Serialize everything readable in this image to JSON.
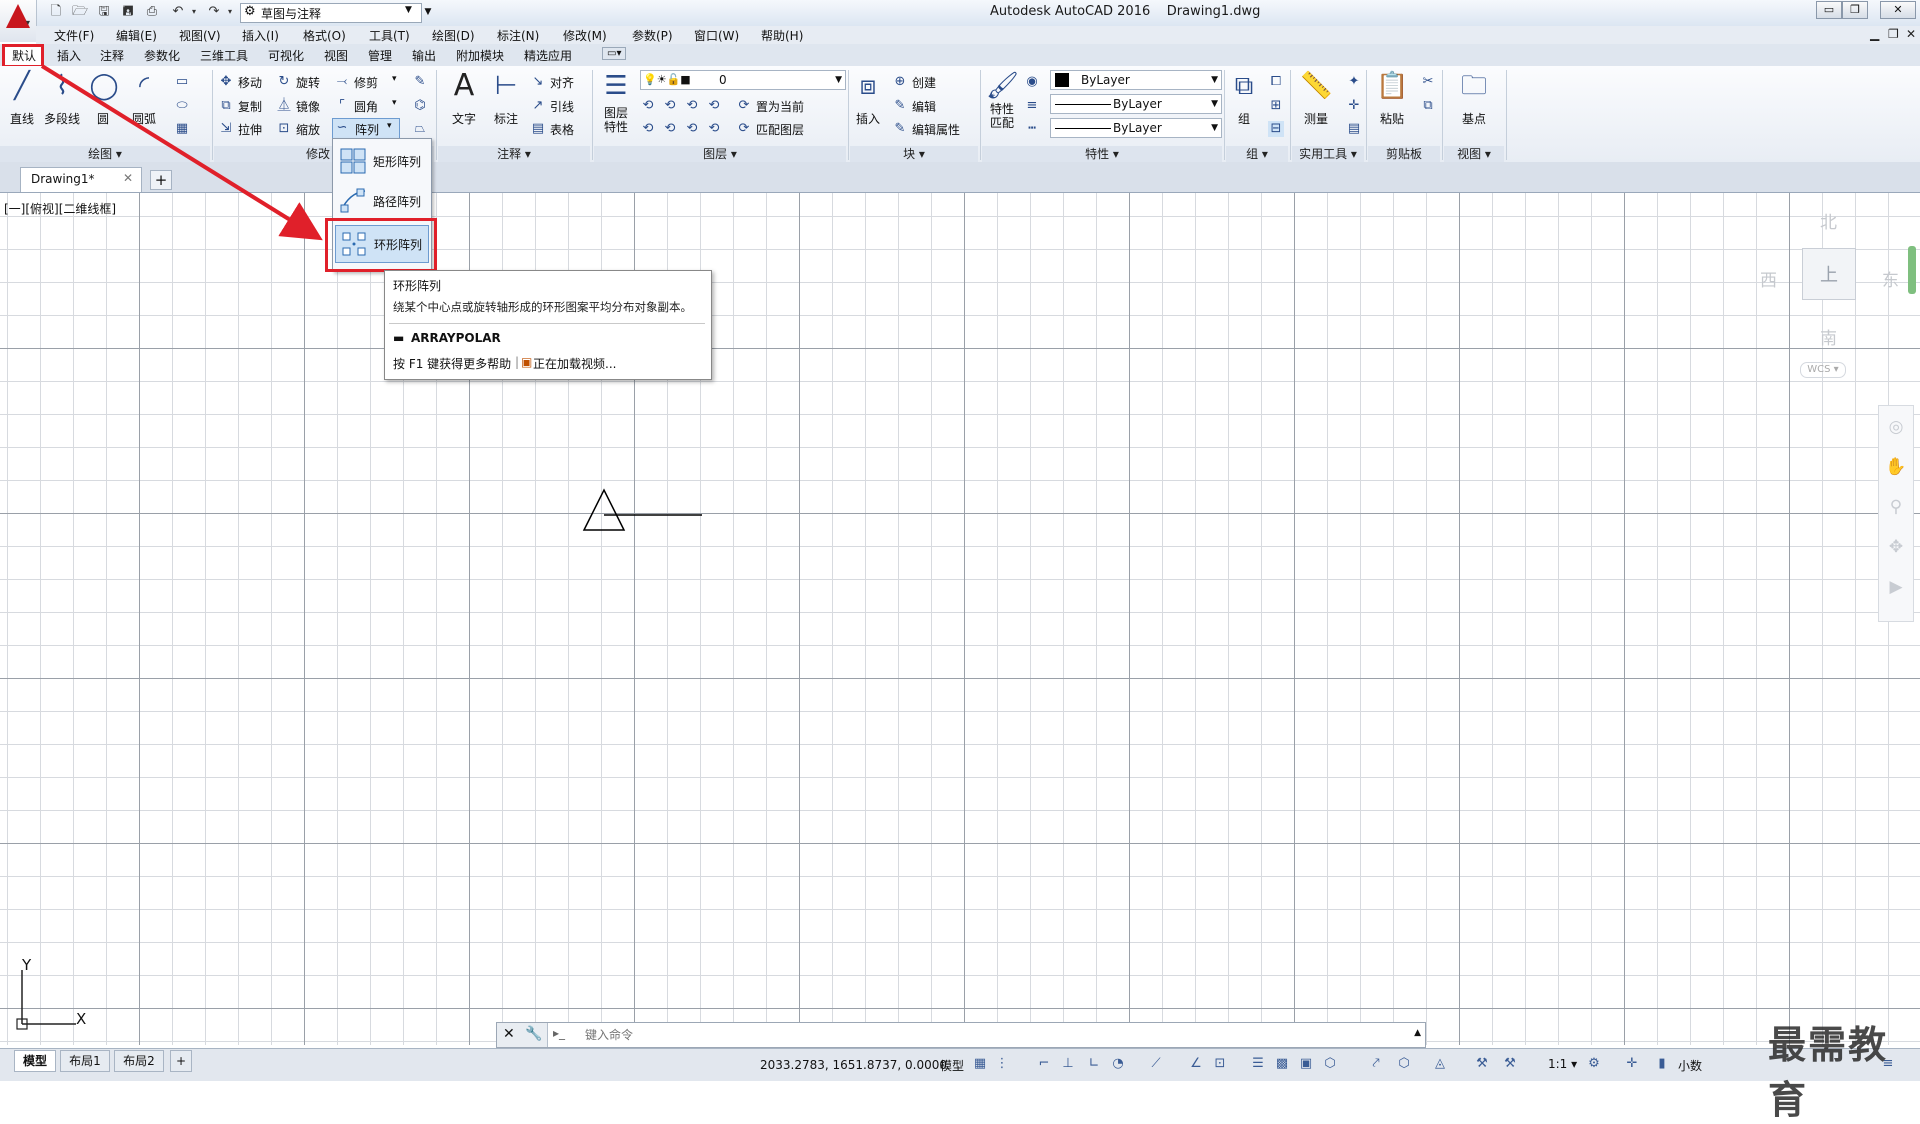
{
  "window": {
    "title": "Autodesk AutoCAD 2016    Drawing1.dwg",
    "workspace": "草图与注释",
    "min": "▭",
    "restore": "❐",
    "close": "✕"
  },
  "menubar": {
    "items": [
      "文件(F)",
      "编辑(E)",
      "视图(V)",
      "插入(I)",
      "格式(O)",
      "工具(T)",
      "绘图(D)",
      "标注(N)",
      "修改(M)",
      "参数(P)",
      "窗口(W)",
      "帮助(H)"
    ],
    "right": [
      "▁",
      "❐",
      "✕"
    ]
  },
  "ribbon_tabs": [
    "默认",
    "插入",
    "注释",
    "参数化",
    "三维工具",
    "可视化",
    "视图",
    "管理",
    "输出",
    "附加模块",
    "精选应用"
  ],
  "panels": {
    "draw": {
      "title": "绘图 ▾",
      "line": "直线",
      "pline": "多段线",
      "circle": "圆",
      "arc": "圆弧"
    },
    "modify": {
      "title": "修改",
      "move": "移动",
      "rotate": "旋转",
      "trim": "修剪",
      "copy": "复制",
      "mirror": "镜像",
      "fillet": "圆角",
      "stretch": "拉伸",
      "scale": "缩放",
      "array": "阵列"
    },
    "annotation": {
      "title": "注释 ▾",
      "text": "文字",
      "dim": "标注",
      "align": "对齐",
      "leader": "引线",
      "table": "表格"
    },
    "layers": {
      "title": "图层 ▾",
      "props": "图层\n特性",
      "layer_value": "0",
      "set_current": "置为当前",
      "match": "匹配图层"
    },
    "block": {
      "title": "块 ▾",
      "insert": "插入",
      "create": "创建",
      "edit": "编辑",
      "edit_attr": "编辑属性"
    },
    "properties": {
      "title": "特性 ▾",
      "match": "特性\n匹配",
      "color": "ByLayer",
      "linetype": "ByLayer",
      "lineweight": "ByLayer"
    },
    "groups": {
      "title": "组 ▾",
      "group": "组"
    },
    "utilities": {
      "title": "实用工具 ▾",
      "measure": "测量"
    },
    "clipboard": {
      "title": "剪贴板",
      "paste": "粘贴"
    },
    "view": {
      "title": "视图 ▾",
      "base": "基点"
    }
  },
  "doc_tab": {
    "name": "Drawing1*",
    "close": "✕",
    "new": "+"
  },
  "viewport_label": "[一][俯视][二维线框]",
  "array_menu": {
    "items": [
      {
        "label": "矩形阵列"
      },
      {
        "label": "路径阵列"
      },
      {
        "label": "环形阵列"
      }
    ]
  },
  "tooltip": {
    "title": "环形阵列",
    "desc": "绕某个中心点或旋转轴形成的环形图案平均分布对象副本。",
    "command": "ARRAYPOLAR",
    "help": "按 F1 键获得更多帮助",
    "video": "正在加载视频..."
  },
  "compass": {
    "n": "北",
    "s": "南",
    "e": "东",
    "w": "西",
    "cube": "上",
    "wcs": "WCS ▾"
  },
  "ucs": {
    "x": "X",
    "y": "Y"
  },
  "cmdline": {
    "placeholder": "键入命令",
    "prompt": "▸_"
  },
  "layout_tabs": [
    "模型",
    "布局1",
    "布局2"
  ],
  "statusbar": {
    "coords": "2033.2783, 1651.8737, 0.0000",
    "model": "模型",
    "scale": "1:1 ▾",
    "units": "小数"
  },
  "watermark": "最需教育",
  "colors": {
    "annotation_red": "#e0202a",
    "ribbon_bg": "#e8edf4",
    "selection_blue": "#cfe3f6"
  }
}
